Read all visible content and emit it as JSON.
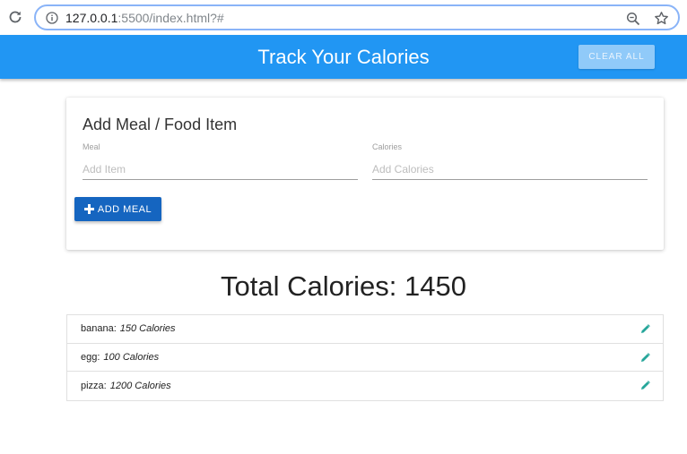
{
  "browser": {
    "url_host": "127.0.0.1",
    "url_rest": ":5500/index.html?#"
  },
  "header": {
    "title": "Track Your Calories",
    "clear_label": "CLEAR ALL"
  },
  "form": {
    "title": "Add Meal / Food Item",
    "meal_label": "Meal",
    "meal_placeholder": "Add Item",
    "meal_value": "",
    "calories_label": "Calories",
    "calories_placeholder": "Add Calories",
    "calories_value": "",
    "add_label": "ADD MEAL"
  },
  "total": {
    "text": "Total Calories: 1450"
  },
  "items": [
    {
      "name": "banana:",
      "calories": "150 Calories"
    },
    {
      "name": "egg:",
      "calories": "100 Calories"
    },
    {
      "name": "pizza:",
      "calories": "1200 Calories"
    }
  ],
  "colors": {
    "primary": "#2196f3",
    "button": "#1565c0",
    "edit": "#26a69a"
  }
}
